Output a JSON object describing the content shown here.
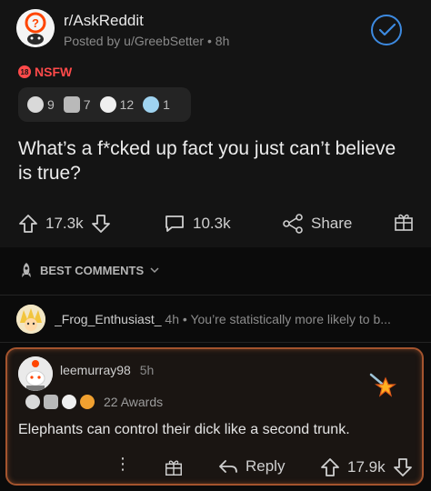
{
  "post": {
    "subreddit": "r/AskReddit",
    "posted_by": "Posted by u/GreebSetter",
    "age": "8h",
    "nsfw_badge": "18",
    "nsfw_label": "NSFW",
    "awards": [
      {
        "icon": "silver-award-icon",
        "count": "9"
      },
      {
        "icon": "helpful-award-icon",
        "count": "7"
      },
      {
        "icon": "wholesome-award-icon",
        "count": "12"
      },
      {
        "icon": "laughing-award-icon",
        "count": "1"
      }
    ],
    "title": "What’s a f*cked up fact you just can’t believe is true?",
    "upvotes": "17.3k",
    "comments": "10.3k",
    "share_label": "Share"
  },
  "sort": {
    "label": "BEST COMMENTS"
  },
  "comments": [
    {
      "user": "_Frog_Enthusiast_",
      "age": "4h",
      "preview": "You’re statistically more likely to b..."
    },
    {
      "user": "leemurray98",
      "age": "5h",
      "awards_label": "22 Awards",
      "body": "Elephants can control their dick like a second trunk.",
      "reply_label": "Reply",
      "score": "17.9k",
      "dots": "⋮"
    }
  ],
  "colors": {
    "accent": "#3d8ae0",
    "nsfw": "#ff4a4a",
    "highlight_border": "#a4542e"
  }
}
